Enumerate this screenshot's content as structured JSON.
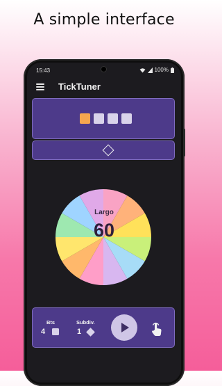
{
  "promo": {
    "headline": "A simple interface"
  },
  "status_bar": {
    "time": "15:43",
    "battery": "100%"
  },
  "app": {
    "title": "TickTuner"
  },
  "beat_indicator": {
    "beats": [
      {
        "active": true
      },
      {
        "active": false
      },
      {
        "active": false
      },
      {
        "active": false
      }
    ],
    "active_color": "#f6a74f",
    "inactive_color": "#d9d3ea"
  },
  "accent_mode": {
    "icon": "diamond-icon"
  },
  "tempo": {
    "marking": "Largo",
    "bpm": "60",
    "wheel_colors": [
      "#f9a3c4",
      "#ffb27a",
      "#ffe15a",
      "#c9f07a",
      "#a7dcf7",
      "#d8b7f0",
      "#ff9ec8",
      "#ffb86b",
      "#ffe66d",
      "#9ee8b0",
      "#9fd4ff",
      "#e0a9e8"
    ]
  },
  "controls": {
    "beats_label": "Bts",
    "beats_value": "4",
    "subdiv_label": "Subdiv.",
    "subdiv_value": "1",
    "play_icon": "play-icon",
    "tap_icon": "tap-tempo-icon"
  },
  "colors": {
    "card_bg": "#4d3a8a",
    "card_border": "#7f6cc0",
    "screen_bg": "#1c1b1f"
  }
}
